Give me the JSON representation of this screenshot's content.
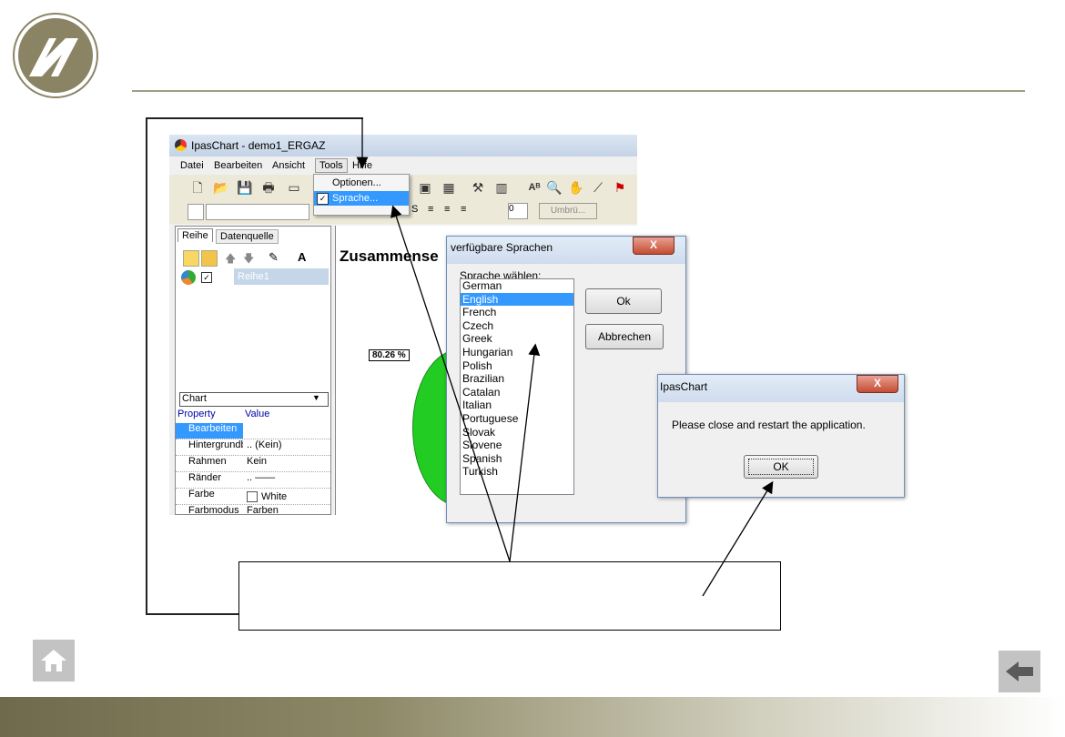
{
  "app": {
    "title": "IpasChart - demo1_ERGAZ",
    "menu": [
      "Datei",
      "Bearbeiten",
      "Ansicht",
      "Tools",
      "Hilfe"
    ],
    "tools_menu": [
      "Optionen...",
      "Sprache..."
    ],
    "toolbar2": {
      "size_value": "0",
      "wrap_label": "Umbrü..."
    },
    "left_tabs": [
      "Reihe",
      "Datenquelle"
    ],
    "series_name": "Reihe1",
    "chart_title_partial": "Zusammense",
    "pie_label": "80.26 %",
    "object_select": "Chart",
    "grid_headers": [
      "Property",
      "Value"
    ],
    "grid_rows": [
      {
        "property": "Bearbeiten",
        "value": ""
      },
      {
        "property": "Hintergrundbl",
        "value": ".. (Kein)"
      },
      {
        "property": "Rahmen",
        "value": "Kein"
      },
      {
        "property": "Ränder",
        "value": ".. ——"
      },
      {
        "property": "Farbe",
        "value": "White"
      },
      {
        "property": "Farbmodus",
        "value": "Farben"
      }
    ]
  },
  "lang_dialog": {
    "title": "verfügbare Sprachen",
    "label": "Sprache wählen:",
    "ok": "Ok",
    "cancel": "Abbrechen",
    "close": "X",
    "languages": [
      "German",
      "English",
      "French",
      "Czech",
      "Greek",
      "Hungarian",
      "Polish",
      "Brazilian",
      "Catalan",
      "Italian",
      "Portuguese",
      "Slovak",
      "Slovene",
      "Spanish",
      "Turkish"
    ],
    "selected": "English"
  },
  "restart_dialog": {
    "title": "IpasChart",
    "message": "Please close and restart the application.",
    "ok": "OK",
    "close": "X"
  },
  "colors": {
    "accent": "#8a8465",
    "selection": "#3399ff",
    "pie": "#22cc22"
  },
  "icons": [
    "logo-icon",
    "home-icon",
    "back-arrow-icon",
    "close-icon"
  ]
}
